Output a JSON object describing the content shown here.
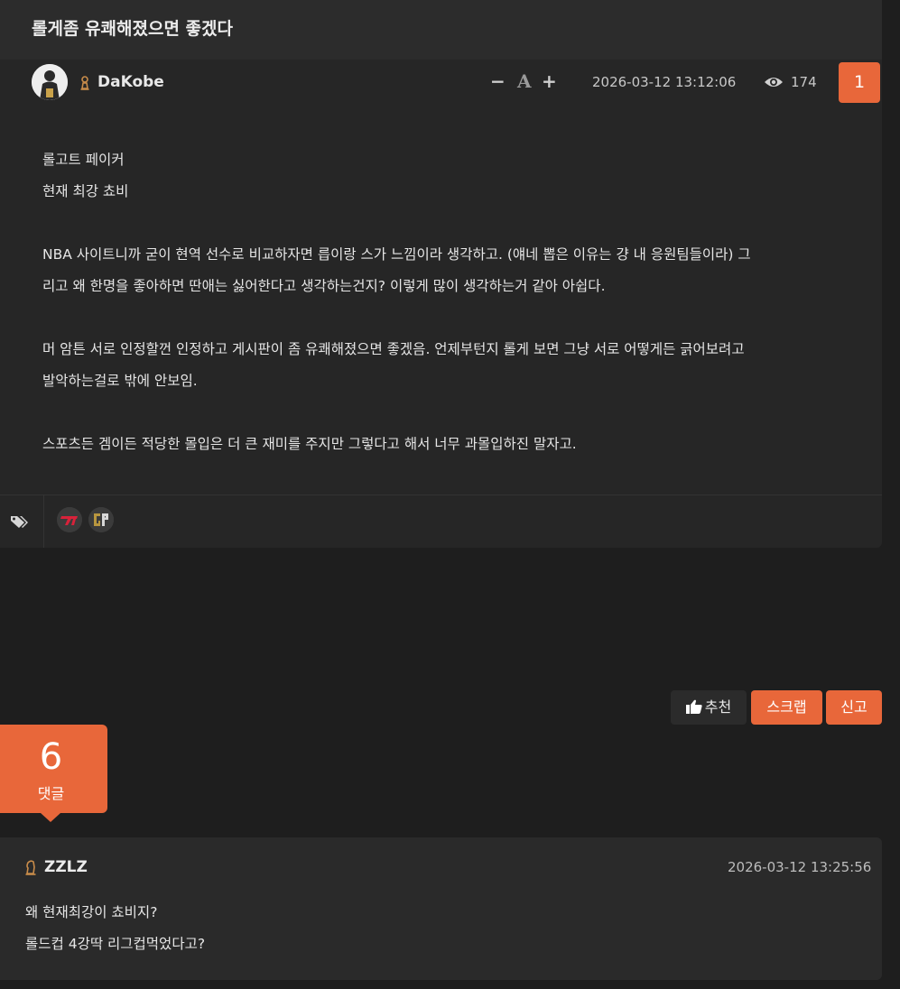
{
  "post": {
    "title": "롤게좀 유쾌해졌으면 좋겠다",
    "author": "DaKobe",
    "font_controls": {
      "minus": "−",
      "font": "A",
      "plus": "+"
    },
    "date": "2026-03-12 13:12:06",
    "views": "174",
    "number_badge": "1",
    "body_lines": [
      "롤고트 페이커",
      "현재 최강 쵸비",
      "",
      "NBA 사이트니까 굳이 현역 선수로 비교하자면 릅이랑 스가 느낌이라 생각하고. (얘네 뽑은 이유는 걍 내 응원팀들이라) 그",
      "리고 왜 한명을 좋아하면 딴애는 싫어한다고 생각하는건지? 이렇게 많이 생각하는거 같아 아쉽다.",
      "",
      "머 암튼 서로 인정할껀 인정하고 게시판이 좀 유쾌해졌으면 좋겠음. 언제부턴지 롤게 보면 그냥 서로 어떻게든 긁어보려고",
      "발악하는걸로 밖에 안보임.",
      "",
      "스포츠든 겜이든 적당한 몰입은 더 큰 재미를 주지만 그렇다고 해서 너무 과몰입하진 말자고."
    ],
    "tags": [
      "tag-icon",
      "t1-logo",
      "gen-g-logo"
    ]
  },
  "actions": {
    "recommend": "추천",
    "scrap": "스크랩",
    "report": "신고"
  },
  "comments_counter": {
    "count": "6",
    "label": "댓글"
  },
  "comment": {
    "author": "ZZLZ",
    "date": "2026-03-12 13:25:56",
    "lines": [
      "왜 현재최강이 쵸비지?",
      "롤드컵 4강딱 리그컵먹었다고?"
    ]
  },
  "colors": {
    "accent": "#e8673a",
    "background": "#1e1e1e",
    "card": "#262626"
  }
}
